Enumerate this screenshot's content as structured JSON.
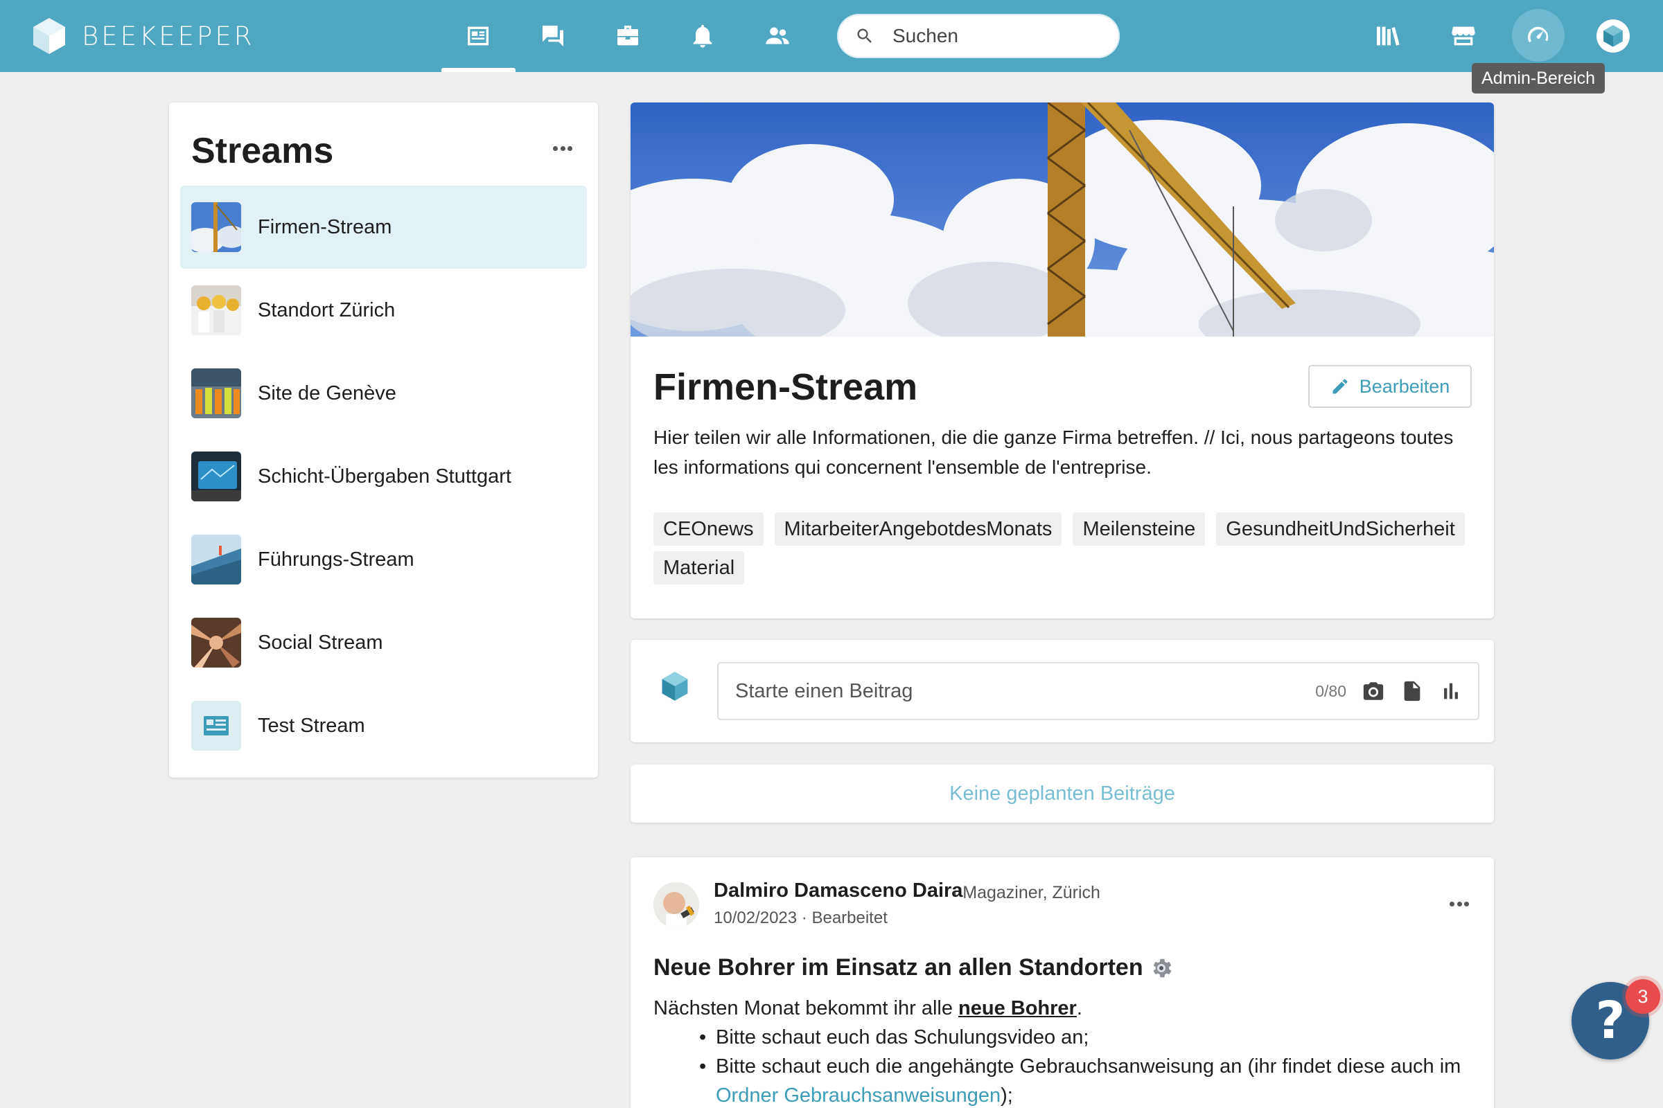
{
  "brand": {
    "name": "BEEKEEPER"
  },
  "nav": {
    "icons": [
      "streams-icon",
      "chat-icon",
      "toolbox-icon",
      "notifications-icon",
      "people-icon"
    ],
    "search_placeholder": "Suchen",
    "right_icons": [
      "library-icon",
      "store-icon",
      "admin-dashboard-icon",
      "profile-icon"
    ],
    "admin_tooltip": "Admin-Bereich"
  },
  "streams": {
    "title": "Streams",
    "items": [
      {
        "label": "Firmen-Stream",
        "active": true
      },
      {
        "label": "Standort Zürich",
        "active": false
      },
      {
        "label": "Site de Genève",
        "active": false
      },
      {
        "label": "Schicht-Übergaben Stuttgart",
        "active": false
      },
      {
        "label": "Führungs-Stream",
        "active": false
      },
      {
        "label": "Social Stream",
        "active": false
      },
      {
        "label": "Test Stream",
        "active": false
      }
    ]
  },
  "stream_header": {
    "title": "Firmen-Stream",
    "edit_label": "Bearbeiten",
    "description": "Hier teilen wir alle Informationen, die die ganze Firma betreffen. // Ici, nous partageons toutes les informations qui concernent l'ensemble de l'entreprise.",
    "tags": [
      "CEOnews",
      "MitarbeiterAngebotdesMonats",
      "Meilensteine",
      "GesundheitUndSicherheit",
      "Material"
    ]
  },
  "composer": {
    "placeholder": "Starte einen Beitrag",
    "counter": "0/80"
  },
  "planned": {
    "label": "Keine geplanten Beiträge"
  },
  "post": {
    "author": "Dalmiro Damasceno Daira",
    "author_meta": "· Magaziner, Zürich",
    "date": "10/02/2023",
    "edited": "· Bearbeitet",
    "title": "Neue Bohrer im Einsatz an allen Standorten",
    "body_intro": "Nächsten Monat bekommt ihr alle ",
    "body_intro_link": "neue Bohrer",
    "body_intro_end": ".",
    "bullet_1": "Bitte schaut euch das Schulungsvideo an;",
    "bullet_2_text": "Bitte schaut euch die angehängte Gebrauchsanweisung an (ihr findet diese auch im ",
    "bullet_2_link": "Ordner Gebrauchsanweisungen",
    "bullet_2_end": ");"
  },
  "help": {
    "label": "?",
    "badge": "3"
  },
  "colors": {
    "topbar": "#4fa7c3",
    "accent": "#3d9cb9",
    "active_item": "#e2f1f6",
    "badge": "#e84b4b"
  }
}
